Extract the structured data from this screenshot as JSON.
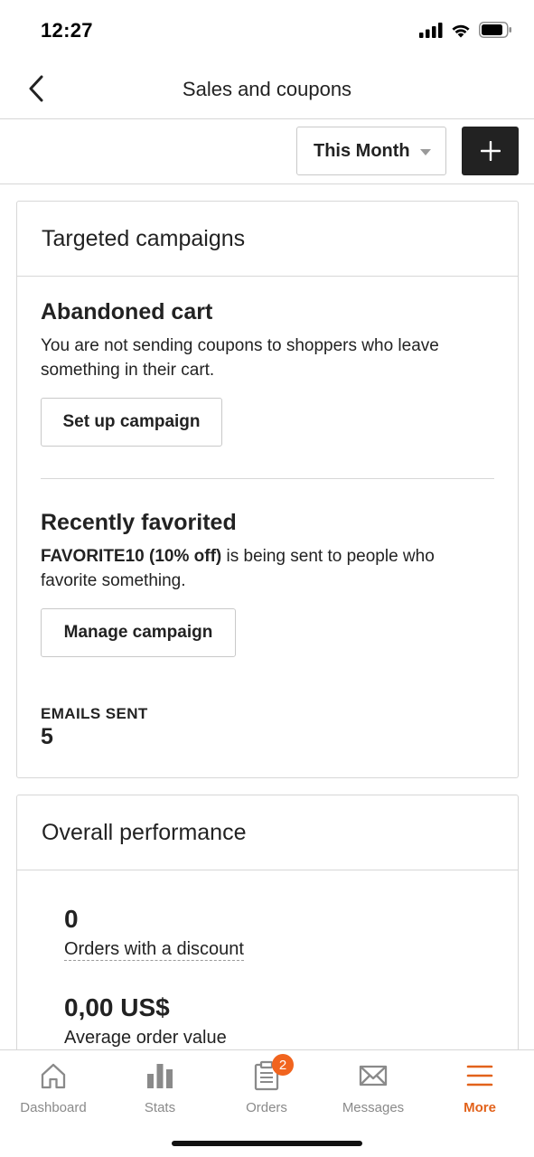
{
  "status_bar": {
    "time": "12:27"
  },
  "header": {
    "title": "Sales and coupons"
  },
  "toolbar": {
    "period": "This Month"
  },
  "targeted_campaigns": {
    "title": "Targeted campaigns",
    "abandoned_cart": {
      "title": "Abandoned cart",
      "description": "You are not sending coupons to shoppers who leave something in their cart.",
      "button": "Set up campaign"
    },
    "recently_favorited": {
      "title": "Recently favorited",
      "coupon": "FAVORITE10 (10% off)",
      "description": " is being sent to people who favorite something.",
      "button": "Manage campaign",
      "emails_sent_label": "EMAILS SENT",
      "emails_sent_value": "5"
    }
  },
  "overall_performance": {
    "title": "Overall performance",
    "orders_value": "0",
    "orders_label": "Orders with a discount",
    "aov_value": "0,00 US$",
    "aov_label": "Average order value"
  },
  "tab_bar": {
    "tabs": [
      {
        "label": "Dashboard",
        "icon": "home-icon"
      },
      {
        "label": "Stats",
        "icon": "bar-chart-icon"
      },
      {
        "label": "Orders",
        "icon": "clipboard-icon",
        "badge": "2"
      },
      {
        "label": "Messages",
        "icon": "envelope-icon"
      },
      {
        "label": "More",
        "icon": "menu-icon"
      }
    ],
    "active_color": "#e2621b",
    "inactive_color": "#8a8a8a"
  }
}
